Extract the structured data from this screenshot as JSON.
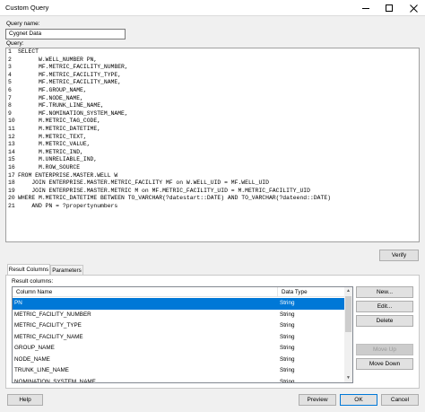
{
  "window": {
    "title": "Custom Query",
    "minimize_icon": "minimize-icon",
    "maximize_icon": "maximize-icon",
    "close_icon": "close-icon"
  },
  "form": {
    "name_label": "Query name:",
    "name_value": "Cygnet Data",
    "query_label": "Query:",
    "verify_label": "Verify"
  },
  "query_lines": [
    {
      "num": "1",
      "text": "SELECT"
    },
    {
      "num": "2",
      "text": "      W.WELL_NUMBER PN,"
    },
    {
      "num": "3",
      "text": "      MF.METRIC_FACILITY_NUMBER,"
    },
    {
      "num": "4",
      "text": "      MF.METRIC_FACILITY_TYPE,"
    },
    {
      "num": "5",
      "text": "      MF.METRIC_FACILITY_NAME,"
    },
    {
      "num": "6",
      "text": "      MF.GROUP_NAME,"
    },
    {
      "num": "7",
      "text": "      MF.NODE_NAME,"
    },
    {
      "num": "8",
      "text": "      MF.TRUNK_LINE_NAME,"
    },
    {
      "num": "9",
      "text": "      MF.NOMINATION_SYSTEM_NAME,"
    },
    {
      "num": "10",
      "text": "      M.METRIC_TAG_CODE,"
    },
    {
      "num": "11",
      "text": "      M.METRIC_DATETIME,"
    },
    {
      "num": "12",
      "text": "      M.METRIC_TEXT,"
    },
    {
      "num": "13",
      "text": "      M.METRIC_VALUE,"
    },
    {
      "num": "14",
      "text": "      M.METRIC_IND,"
    },
    {
      "num": "15",
      "text": "      M.UNRELIABLE_IND,"
    },
    {
      "num": "16",
      "text": "      M.ROW_SOURCE"
    },
    {
      "num": "17",
      "text": "FROM ENTERPRISE.MASTER.WELL W"
    },
    {
      "num": "18",
      "text": "    JOIN ENTERPRISE.MASTER.METRIC_FACILITY MF on W.WELL_UID = MF.WELL_UID"
    },
    {
      "num": "19",
      "text": "    JOIN ENTERPRISE.MASTER.METRIC M on MF.METRIC_FACILITY_UID = M.METRIC_FACILITY_UID"
    },
    {
      "num": "20",
      "text": "WHERE M.METRIC_DATETIME BETWEEN TO_VARCHAR(?datestart::DATE) AND TO_VARCHAR(?dateend::DATE)"
    },
    {
      "num": "21",
      "text": "    AND PN = ?propertynumbers"
    }
  ],
  "tabs": {
    "result_columns": "Result Columns",
    "parameters": "Parameters"
  },
  "results": {
    "label": "Result columns:",
    "headers": {
      "column_name": "Column Name",
      "data_type": "Data Type"
    },
    "rows": [
      {
        "name": "PN",
        "type": "String"
      },
      {
        "name": "METRIC_FACILITY_NUMBER",
        "type": "String"
      },
      {
        "name": "METRIC_FACILITY_TYPE",
        "type": "String"
      },
      {
        "name": "METRIC_FACILITY_NAME",
        "type": "String"
      },
      {
        "name": "GROUP_NAME",
        "type": "String"
      },
      {
        "name": "NODE_NAME",
        "type": "String"
      },
      {
        "name": "TRUNK_LINE_NAME",
        "type": "String"
      },
      {
        "name": "NOMINATION_SYSTEM_NAME",
        "type": "String"
      }
    ],
    "selected_index": 0
  },
  "side_buttons": {
    "new": "New...",
    "edit": "Edit...",
    "delete": "Delete",
    "move_up": "Move Up",
    "move_down": "Move Down"
  },
  "footer": {
    "help": "Help",
    "preview": "Preview",
    "ok": "OK",
    "cancel": "Cancel"
  },
  "colors": {
    "selection": "#0078d7",
    "window_bg": "#f0f0f0"
  }
}
